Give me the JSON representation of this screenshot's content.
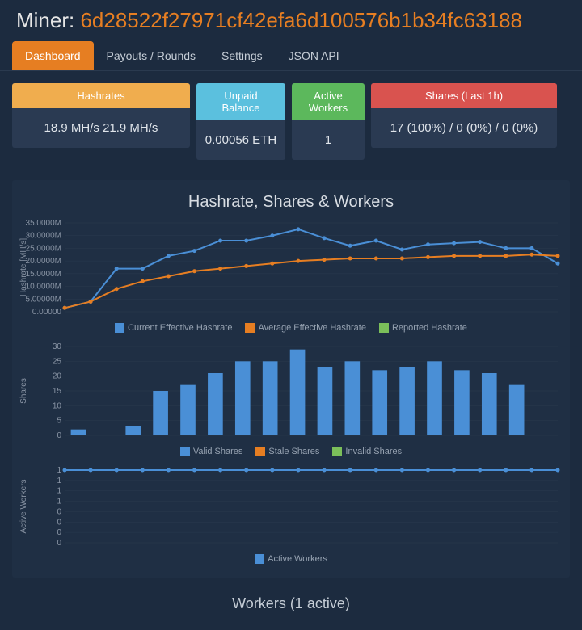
{
  "header": {
    "label": "Miner: ",
    "address": "6d28522f27971cf42efa6d100576b1b34fc63188"
  },
  "tabs": {
    "items": [
      "Dashboard",
      "Payouts / Rounds",
      "Settings",
      "JSON API"
    ],
    "active": 0
  },
  "cards": {
    "hashrates": {
      "title": "Hashrates",
      "value": "18.9 MH/s   21.9 MH/s"
    },
    "unpaid": {
      "title": "Unpaid Balance",
      "value": "0.00056 ETH"
    },
    "workers": {
      "title": "Active Workers",
      "value": "1"
    },
    "shares": {
      "title": "Shares (Last 1h)",
      "value": "17 (100%) / 0 (0%) / 0 (0%)"
    }
  },
  "charts_title": "Hashrate, Shares & Workers",
  "workers_section": "Workers (1 active)",
  "chart_data": [
    {
      "type": "line",
      "title": "Hashrate",
      "ylabel": "Hashrate [MH/s]",
      "ylim": [
        0,
        35
      ],
      "yticks": [
        "0.00000",
        "5.00000M",
        "10.0000M",
        "15.0000M",
        "20.0000M",
        "25.0000M",
        "30.0000M",
        "35.0000M"
      ],
      "x": [
        0,
        1,
        2,
        3,
        4,
        5,
        6,
        7,
        8,
        9,
        10,
        11,
        12,
        13,
        14,
        15,
        16,
        17,
        18,
        19
      ],
      "series": [
        {
          "name": "Current Effective Hashrate",
          "color": "#4a8fd6",
          "values": [
            1.5,
            4,
            17,
            17,
            22,
            24,
            28,
            28,
            30,
            32.5,
            29,
            26,
            28,
            24.5,
            26.5,
            27,
            27.5,
            25,
            25,
            19
          ]
        },
        {
          "name": "Average Effective Hashrate",
          "color": "#e67e22",
          "values": [
            1.5,
            4,
            9,
            12,
            14,
            16,
            17,
            18,
            19,
            20,
            20.5,
            21,
            21,
            21,
            21.5,
            22,
            22,
            22,
            22.5,
            22
          ]
        },
        {
          "name": "Reported Hashrate",
          "color": "#7bbf5a",
          "values": []
        }
      ]
    },
    {
      "type": "bar",
      "title": "Shares",
      "ylabel": "Shares",
      "ylim": [
        0,
        30
      ],
      "yticks": [
        "0",
        "5",
        "10",
        "15",
        "20",
        "25",
        "30"
      ],
      "x": [
        0,
        1,
        2,
        3,
        4,
        5,
        6,
        7,
        8,
        9,
        10,
        11,
        12,
        13,
        14,
        15,
        16,
        17
      ],
      "series": [
        {
          "name": "Valid Shares",
          "color": "#4a8fd6",
          "values": [
            2,
            0,
            3,
            15,
            17,
            21,
            25,
            25,
            29,
            23,
            25,
            22,
            23,
            25,
            22,
            21,
            17,
            0
          ]
        },
        {
          "name": "Stale Shares",
          "color": "#e67e22",
          "values": []
        },
        {
          "name": "Invalid Shares",
          "color": "#7bbf5a",
          "values": []
        }
      ]
    },
    {
      "type": "line",
      "title": "Active Workers",
      "ylabel": "Active Workers",
      "ylim": [
        0,
        1
      ],
      "yticks": [
        "0",
        "0",
        "0",
        "0",
        "1",
        "1",
        "1",
        "1"
      ],
      "x": [
        0,
        1,
        2,
        3,
        4,
        5,
        6,
        7,
        8,
        9,
        10,
        11,
        12,
        13,
        14,
        15,
        16,
        17,
        18,
        19
      ],
      "series": [
        {
          "name": "Active Workers",
          "color": "#4a8fd6",
          "values": [
            1,
            1,
            1,
            1,
            1,
            1,
            1,
            1,
            1,
            1,
            1,
            1,
            1,
            1,
            1,
            1,
            1,
            1,
            1,
            1
          ]
        }
      ]
    }
  ]
}
